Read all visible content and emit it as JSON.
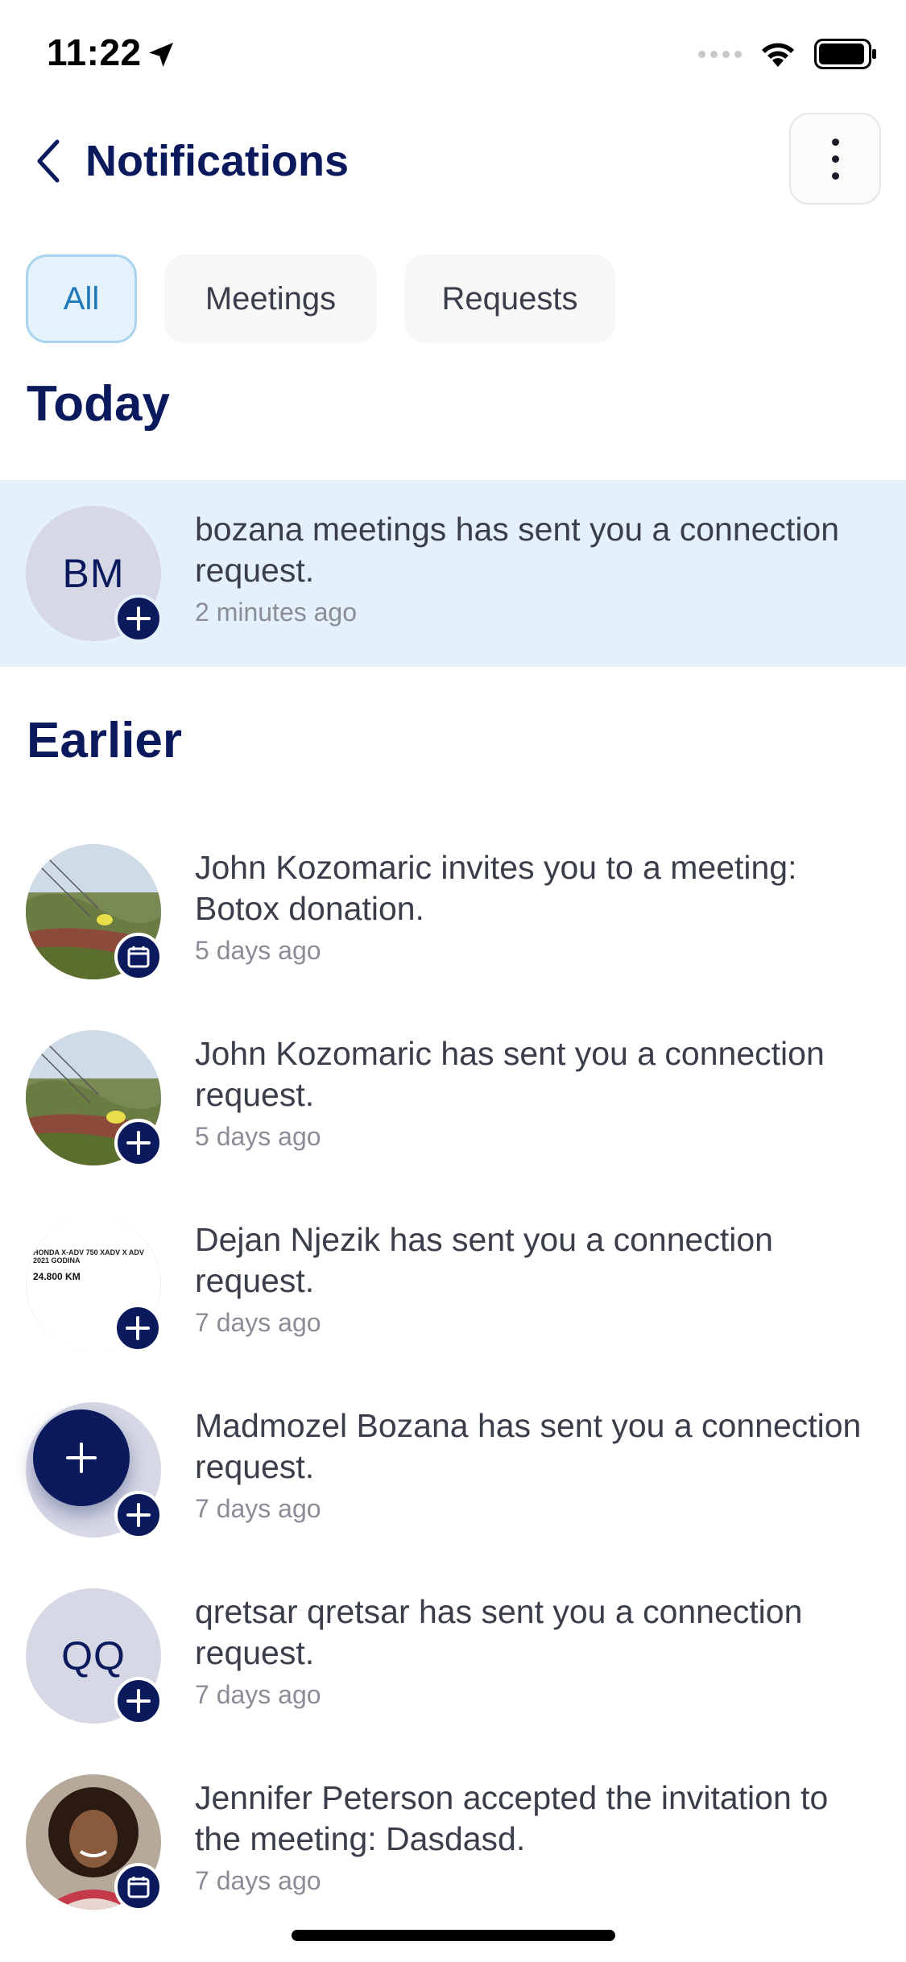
{
  "status_bar": {
    "time": "11:22",
    "location_icon": "location-arrow-icon",
    "wifi_icon": "wifi-icon",
    "battery_icon": "battery-icon"
  },
  "header": {
    "title": "Notifications",
    "back_icon": "chevron-left-icon",
    "menu_icon": "more-vertical-icon"
  },
  "tabs": [
    {
      "label": "All",
      "active": true
    },
    {
      "label": "Meetings",
      "active": false
    },
    {
      "label": "Requests",
      "active": false
    }
  ],
  "sections": {
    "today": "Today",
    "earlier": "Earlier"
  },
  "notifications": [
    {
      "initials": "BM",
      "message": "bozana meetings has sent you a connection request.",
      "time": "2 minutes ago",
      "badge": "plus-icon"
    },
    {
      "initials": "",
      "message": "John Kozomaric invites you to a meeting: Botox donation.",
      "time": "5 days ago",
      "badge": "calendar-icon"
    },
    {
      "initials": "",
      "message": "John Kozomaric has sent you a connection request.",
      "time": "5 days ago",
      "badge": "plus-icon"
    },
    {
      "initials": "",
      "message": "Dejan Njezik has sent you a connection request.",
      "time": "7 days ago",
      "badge": "plus-icon"
    },
    {
      "initials": "",
      "message": "Madmozel Bozana has sent you a connection request.",
      "time": "7 days ago",
      "badge": "plus-icon"
    },
    {
      "initials": "QQ",
      "message": "qretsar qretsar has sent you a connection request.",
      "time": "7 days ago",
      "badge": "plus-icon"
    },
    {
      "initials": "",
      "message": "Jennifer Peterson accepted the invitation to the meeting: Dasdasd.",
      "time": "7 days ago",
      "badge": "calendar-icon"
    }
  ],
  "avatar_thumbnail": {
    "text_line1": "HONDA X-ADV 750 XADV X ADV",
    "text_line2": "2021 GODINA",
    "price": "24.800 KM"
  },
  "colors": {
    "primary": "#0b1a5c",
    "highlight_bg": "#e5f1fa",
    "tab_active_bg": "#e4f2fb",
    "tab_active_text": "#1f78b8"
  }
}
